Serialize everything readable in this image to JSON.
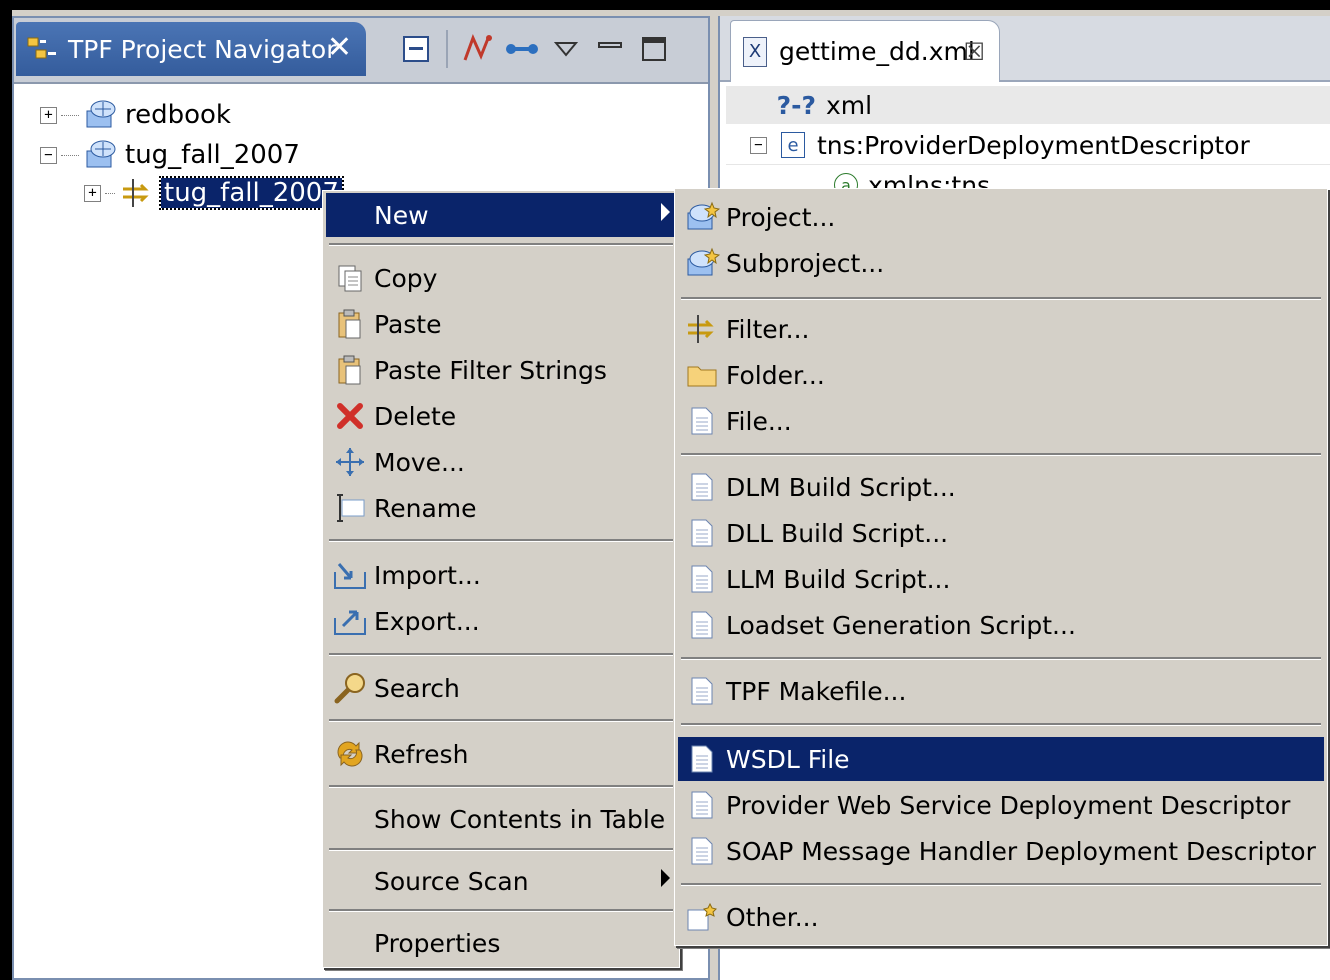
{
  "navigator": {
    "tab_title": "TPF Project Navigator",
    "tree": [
      {
        "label": "redbook"
      },
      {
        "label": "tug_fall_2007"
      },
      {
        "label": "tug_fall_2007"
      }
    ]
  },
  "editor": {
    "tab_title": "gettime_dd.xml",
    "rows": [
      {
        "label": "xml",
        "marker": "?-?"
      },
      {
        "label": "tns:ProviderDeploymentDescriptor",
        "marker": "e"
      },
      {
        "label": "xmlns:tns",
        "marker": "a"
      }
    ]
  },
  "context_menu": {
    "items": [
      {
        "label": "New"
      },
      {
        "label": "Copy"
      },
      {
        "label": "Paste"
      },
      {
        "label": "Paste Filter Strings"
      },
      {
        "label": "Delete"
      },
      {
        "label": "Move..."
      },
      {
        "label": "Rename"
      },
      {
        "label": "Import..."
      },
      {
        "label": "Export..."
      },
      {
        "label": "Search"
      },
      {
        "label": "Refresh"
      },
      {
        "label": "Show Contents in Table"
      },
      {
        "label": "Source Scan"
      },
      {
        "label": "Properties"
      }
    ]
  },
  "new_submenu": {
    "items": [
      {
        "label": "Project..."
      },
      {
        "label": "Subproject..."
      },
      {
        "label": "Filter..."
      },
      {
        "label": "Folder..."
      },
      {
        "label": "File..."
      },
      {
        "label": "DLM Build Script..."
      },
      {
        "label": "DLL Build Script..."
      },
      {
        "label": "LLM Build Script..."
      },
      {
        "label": "Loadset Generation Script..."
      },
      {
        "label": "TPF Makefile..."
      },
      {
        "label": "WSDL File"
      },
      {
        "label": "Provider Web Service Deployment Descriptor"
      },
      {
        "label": "SOAP Message Handler Deployment Descriptor"
      },
      {
        "label": "Other..."
      }
    ]
  },
  "colors": {
    "selection": "#0a246a",
    "menu_bg": "#d4d0c8",
    "view_tab_active": "#3f67a8"
  }
}
